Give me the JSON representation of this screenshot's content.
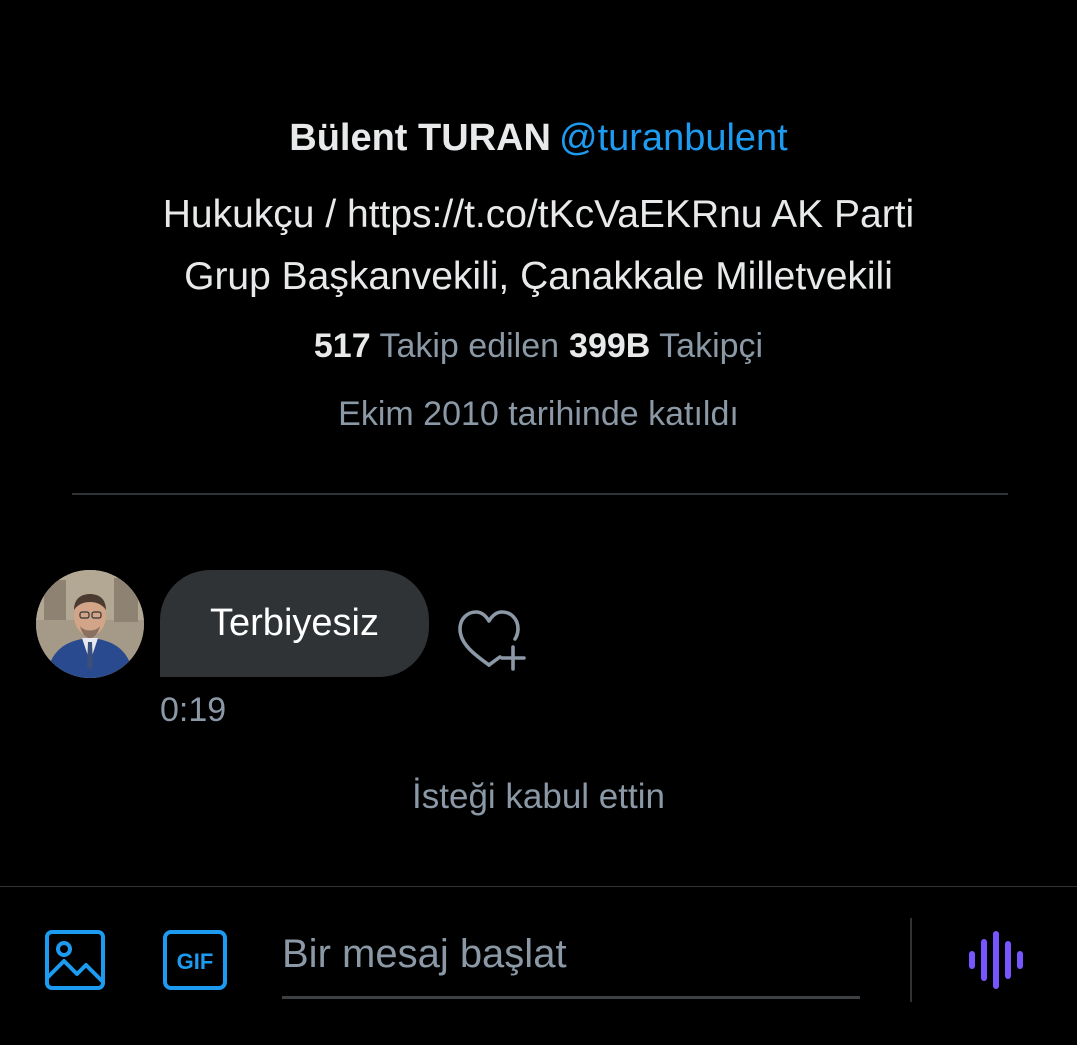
{
  "profile": {
    "display_name": "Bülent TURAN",
    "handle": "@turanbulent",
    "bio_line1": "Hukukçu / https://t.co/tKcVaEKRnu AK Parti",
    "bio_line2": "Grup Başkanvekili, Çanakkale Milletvekili",
    "following_count": "517",
    "following_label": "Takip edilen",
    "followers_count": "399B",
    "followers_label": "Takipçi",
    "joined": "Ekim 2010 tarihinde katıldı"
  },
  "message": {
    "text": "Terbiyesiz",
    "time": "0:19"
  },
  "system_message": "İsteği kabul ettin",
  "composer": {
    "placeholder": "Bir mesaj başlat",
    "gif_label": "GIF",
    "accent_color": "#1d9bf0",
    "voice_color": "#7856ff"
  },
  "icons": {
    "reaction": "heart-plus-icon",
    "media": "image-icon",
    "gif": "gif-icon",
    "voice": "voice-waveform-icon"
  }
}
